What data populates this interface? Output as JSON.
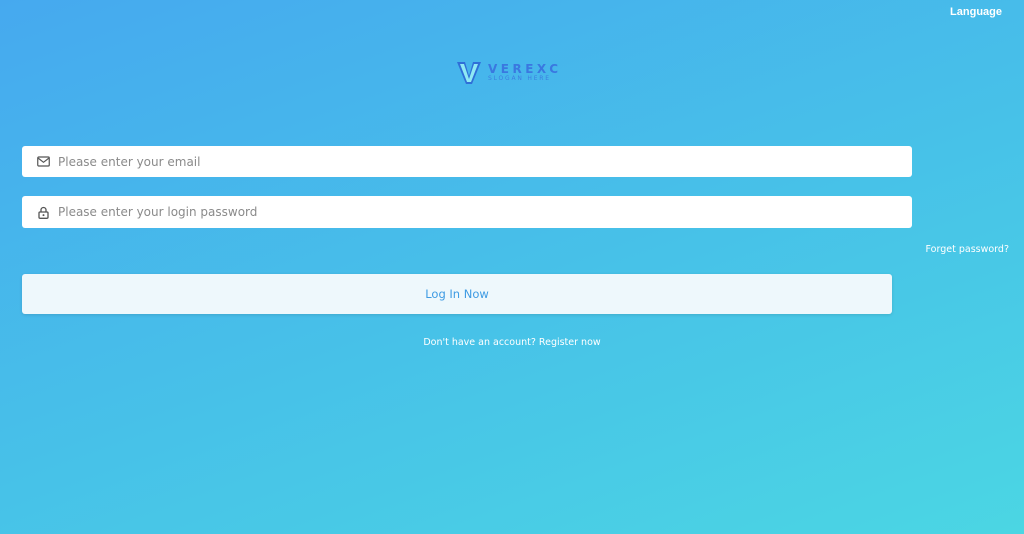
{
  "header": {
    "language_label": "Language"
  },
  "logo": {
    "name": "VEREXC",
    "slogan": "SLOGAN HERE",
    "colors": {
      "mark_outer": "#2f6fd8",
      "mark_inner": "#8fe9f4",
      "text": "#3a78e0"
    }
  },
  "form": {
    "email": {
      "placeholder": "Please enter your email",
      "value": "",
      "icon": "mail-icon"
    },
    "password": {
      "placeholder": "Please enter your login password",
      "value": "",
      "icon": "lock-icon"
    },
    "forget_password_label": "Forget password?",
    "login_button_label": "Log In Now",
    "register_prompt": "Don't have an account? ",
    "register_link_label": "Register now"
  },
  "colors": {
    "background_start": "#46a9ef",
    "background_end": "#4bd6e3",
    "button_bg": "#eef8fc",
    "button_text": "#3e9be3"
  }
}
